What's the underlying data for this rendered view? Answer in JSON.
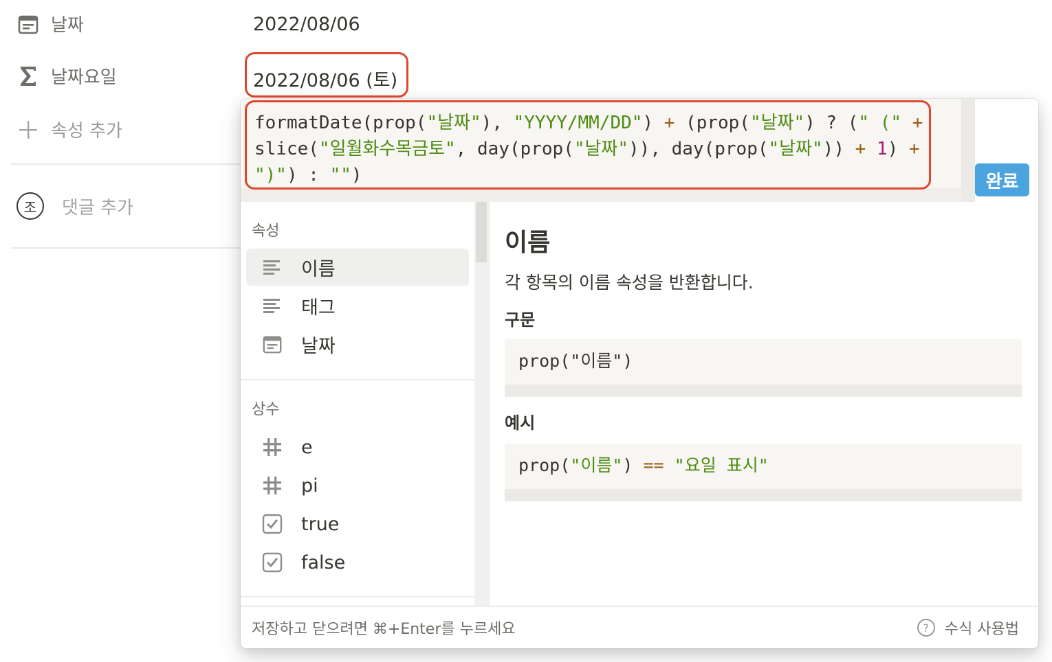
{
  "properties": [
    {
      "icon": "calendar-icon",
      "name": "날짜",
      "value": "2022/08/06"
    },
    {
      "icon": "sigma-icon",
      "name": "날짜요일",
      "value": "2022/08/06 (토)"
    }
  ],
  "add_property_label": "속성 추가",
  "comment": {
    "avatar_letter": "조",
    "placeholder": "댓글 추가"
  },
  "formula": {
    "lines": [
      [
        {
          "t": "formatDate(prop(",
          "c": ""
        },
        {
          "t": "\"날짜\"",
          "c": "str"
        },
        {
          "t": "), ",
          "c": ""
        },
        {
          "t": "\"YYYY/MM/DD\"",
          "c": "str"
        },
        {
          "t": ") ",
          "c": ""
        },
        {
          "t": "+",
          "c": "op"
        },
        {
          "t": " (prop(",
          "c": ""
        },
        {
          "t": "\"날짜\"",
          "c": "str"
        },
        {
          "t": ") ? (",
          "c": ""
        },
        {
          "t": "\" (\"",
          "c": "str"
        },
        {
          "t": " ",
          "c": ""
        },
        {
          "t": "+",
          "c": "op"
        }
      ],
      [
        {
          "t": "slice(",
          "c": ""
        },
        {
          "t": "\"일월화수목금토\"",
          "c": "str"
        },
        {
          "t": ", day(prop(",
          "c": ""
        },
        {
          "t": "\"날짜\"",
          "c": "str"
        },
        {
          "t": ")), day(prop(",
          "c": ""
        },
        {
          "t": "\"날짜\"",
          "c": "str"
        },
        {
          "t": ")) ",
          "c": ""
        },
        {
          "t": "+",
          "c": "op"
        },
        {
          "t": " ",
          "c": ""
        },
        {
          "t": "1",
          "c": "num"
        },
        {
          "t": ") ",
          "c": ""
        },
        {
          "t": "+",
          "c": "op"
        }
      ],
      [
        {
          "t": "\")\"",
          "c": "str"
        },
        {
          "t": ") : ",
          "c": ""
        },
        {
          "t": "\"\"",
          "c": "str"
        },
        {
          "t": ")",
          "c": ""
        }
      ]
    ],
    "done_label": "완료"
  },
  "sidebar": {
    "sections": [
      {
        "title": "속성",
        "items": [
          {
            "icon": "text-lines-icon",
            "label": "이름",
            "selected": true
          },
          {
            "icon": "text-lines-icon",
            "label": "태그",
            "selected": false
          },
          {
            "icon": "calendar-icon",
            "label": "날짜",
            "selected": false
          }
        ]
      },
      {
        "title": "상수",
        "items": [
          {
            "icon": "hash-icon",
            "label": "e",
            "selected": false
          },
          {
            "icon": "hash-icon",
            "label": "pi",
            "selected": false
          },
          {
            "icon": "checkbox-icon",
            "label": "true",
            "selected": false
          },
          {
            "icon": "checkbox-icon",
            "label": "false",
            "selected": false
          }
        ]
      }
    ]
  },
  "doc": {
    "title": "이름",
    "description": "각 항목의 이름 속성을 반환합니다.",
    "syntax_heading": "구문",
    "syntax_code": "prop(\"이름\")",
    "example_heading": "예시",
    "example_code": [
      {
        "t": "prop(",
        "c": ""
      },
      {
        "t": "\"이름\"",
        "c": "str"
      },
      {
        "t": ") ",
        "c": ""
      },
      {
        "t": "==",
        "c": "op"
      },
      {
        "t": " ",
        "c": ""
      },
      {
        "t": "\"요일 표시\"",
        "c": "str"
      }
    ]
  },
  "footer": {
    "hint": "저장하고 닫으려면 ⌘+Enter를 누르세요",
    "help_label": "수식 사용법",
    "help_icon": "question-circle-icon"
  },
  "colors": {
    "highlight_border": "#e0462e",
    "done_button": "#4ba3df",
    "string_token": "#4d8b11",
    "operator_token": "#9b5d0e",
    "number_token": "#a61e70"
  }
}
